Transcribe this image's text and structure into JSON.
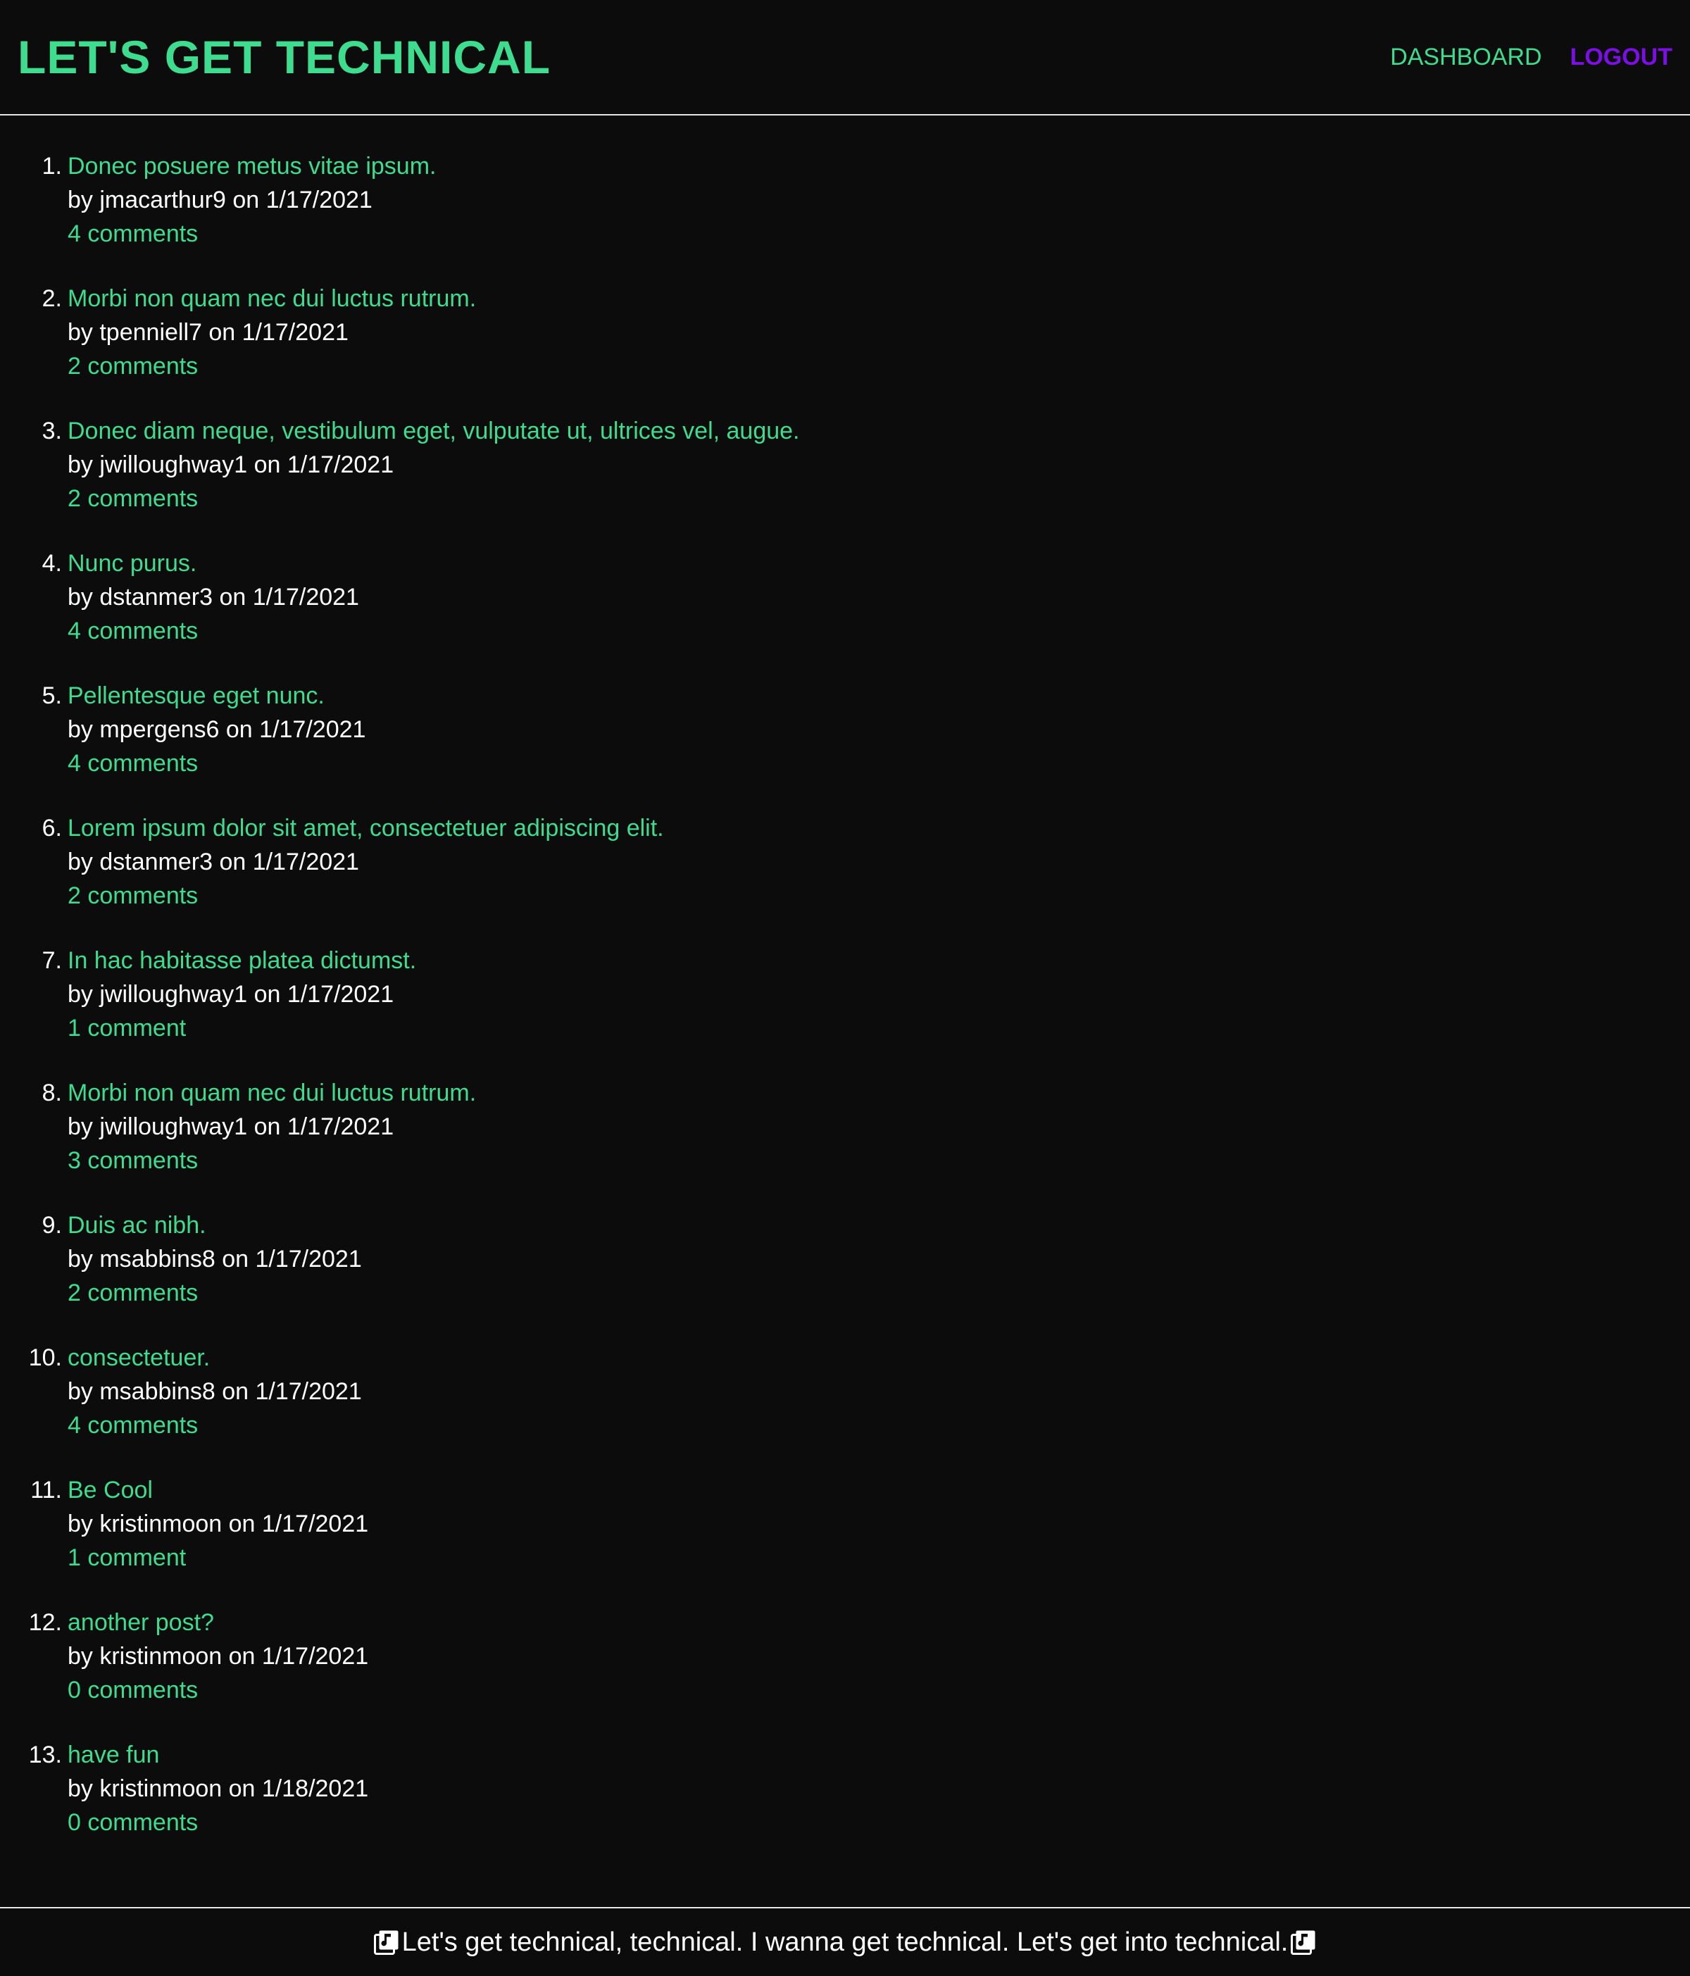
{
  "header": {
    "title": "LET'S GET TECHNICAL",
    "nav": {
      "dashboard": "DASHBOARD",
      "logout": "LOGOUT"
    }
  },
  "posts": [
    {
      "num": "1.",
      "title": "Donec posuere metus vitae ipsum.",
      "meta": "by jmacarthur9 on 1/17/2021",
      "comments": "4 comments"
    },
    {
      "num": "2.",
      "title": "Morbi non quam nec dui luctus rutrum.",
      "meta": "by tpenniell7 on 1/17/2021",
      "comments": "2 comments"
    },
    {
      "num": "3.",
      "title": "Donec diam neque, vestibulum eget, vulputate ut, ultrices vel, augue.",
      "meta": "by jwilloughway1 on 1/17/2021",
      "comments": "2 comments"
    },
    {
      "num": "4.",
      "title": "Nunc purus.",
      "meta": "by dstanmer3 on 1/17/2021",
      "comments": "4 comments"
    },
    {
      "num": "5.",
      "title": "Pellentesque eget nunc.",
      "meta": "by mpergens6 on 1/17/2021",
      "comments": "4 comments"
    },
    {
      "num": "6.",
      "title": "Lorem ipsum dolor sit amet, consectetuer adipiscing elit.",
      "meta": "by dstanmer3 on 1/17/2021",
      "comments": "2 comments"
    },
    {
      "num": "7.",
      "title": "In hac habitasse platea dictumst.",
      "meta": "by jwilloughway1 on 1/17/2021",
      "comments": "1 comment"
    },
    {
      "num": "8.",
      "title": "Morbi non quam nec dui luctus rutrum.",
      "meta": "by jwilloughway1 on 1/17/2021",
      "comments": "3 comments"
    },
    {
      "num": "9.",
      "title": "Duis ac nibh.",
      "meta": "by msabbins8 on 1/17/2021",
      "comments": "2 comments"
    },
    {
      "num": "10.",
      "title": "consectetuer.",
      "meta": "by msabbins8 on 1/17/2021",
      "comments": "4 comments"
    },
    {
      "num": "11.",
      "title": "Be Cool",
      "meta": "by kristinmoon on 1/17/2021",
      "comments": "1 comment"
    },
    {
      "num": "12.",
      "title": "another post?",
      "meta": "by kristinmoon on 1/17/2021",
      "comments": "0 comments"
    },
    {
      "num": "13.",
      "title": "have fun",
      "meta": "by kristinmoon on 1/18/2021",
      "comments": "0 comments"
    }
  ],
  "footer": {
    "text": "Let's get technical, technical. I wanna get technical. Let's get into technical.",
    "icon_left": "music-note-icon",
    "icon_right": "music-note-icon"
  },
  "colors": {
    "background": "#0c0c0c",
    "accent": "#3edc8f",
    "logout": "#7b0fe6",
    "text": "#ffffff"
  }
}
